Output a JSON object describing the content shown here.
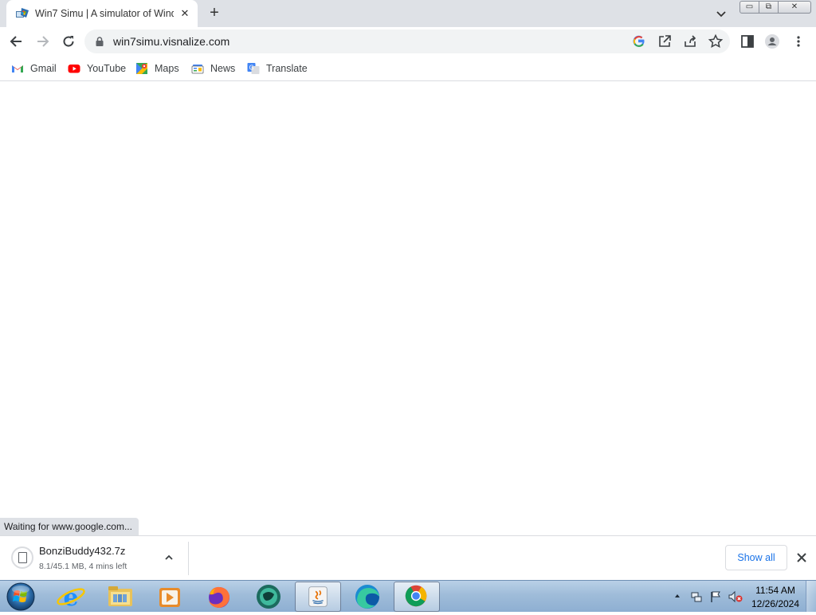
{
  "tab": {
    "title": "Win7 Simu | A simulator of Wind",
    "close": "✕"
  },
  "newtab": "+",
  "window": {
    "minimize": "▭",
    "maximize": "⧉",
    "close": "✕"
  },
  "omnibox": {
    "url": "win7simu.visnalize.com"
  },
  "bookmarks": [
    {
      "label": "Gmail",
      "icon": "gmail-icon"
    },
    {
      "label": "YouTube",
      "icon": "youtube-icon"
    },
    {
      "label": "Maps",
      "icon": "maps-icon"
    },
    {
      "label": "News",
      "icon": "news-icon"
    },
    {
      "label": "Translate",
      "icon": "translate-icon"
    }
  ],
  "status_bubble": "Waiting for www.google.com...",
  "download": {
    "filename": "BonziBuddy432.7z",
    "status": "8.1/45.1 MB, 4 mins left",
    "show_all": "Show all"
  },
  "taskbar": {
    "apps": [
      "internet-explorer",
      "windows-explorer",
      "media-player",
      "firefox",
      "cyberlink",
      "java",
      "edge",
      "chrome"
    ],
    "clock_time": "11:54 AM",
    "clock_date": "12/26/2024"
  },
  "colors": {
    "accent": "#1a73e8",
    "tabstrip": "#dee1e6",
    "omnibox": "#f1f3f4"
  }
}
